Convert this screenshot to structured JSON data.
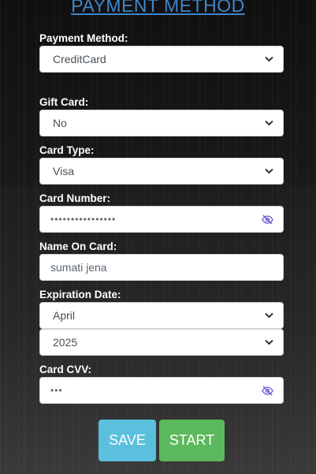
{
  "page": {
    "title": "PAYMENT METHOD"
  },
  "form": {
    "payment_method": {
      "label": "Payment Method:",
      "value": "CreditCard"
    },
    "gift_card": {
      "label": "Gift Card:",
      "value": "No"
    },
    "card_type": {
      "label": "Card Type:",
      "value": "Visa"
    },
    "card_number": {
      "label": "Card Number:",
      "value": "••••••••••••••••"
    },
    "name_on_card": {
      "label": "Name On Card:",
      "value": "sumati jena"
    },
    "expiration": {
      "label": "Expiration Date:",
      "month": "April",
      "year": "2025"
    },
    "cvv": {
      "label": "Card CVV:",
      "value": "•••"
    }
  },
  "buttons": {
    "save": "SAVE",
    "start": "START"
  },
  "icons": {
    "chevron": "chevron-down-icon",
    "eye": "eye-slash-icon"
  },
  "colors": {
    "title_link": "#3f86c9",
    "save_button": "#5bc0de",
    "start_button": "#5cb85c",
    "eye_icon": "#6a5acd"
  }
}
